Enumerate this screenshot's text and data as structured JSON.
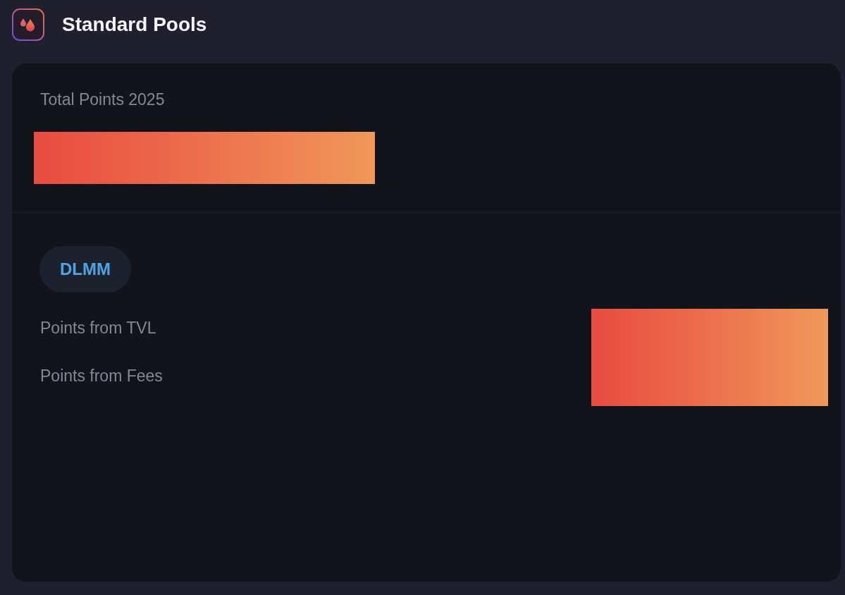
{
  "header": {
    "title": "Standard Pools"
  },
  "total": {
    "label": "Total Points 2025"
  },
  "pools": {
    "badge": "DLMM",
    "rows": [
      {
        "label": "Points from TVL"
      },
      {
        "label": "Points from Fees"
      }
    ]
  }
}
